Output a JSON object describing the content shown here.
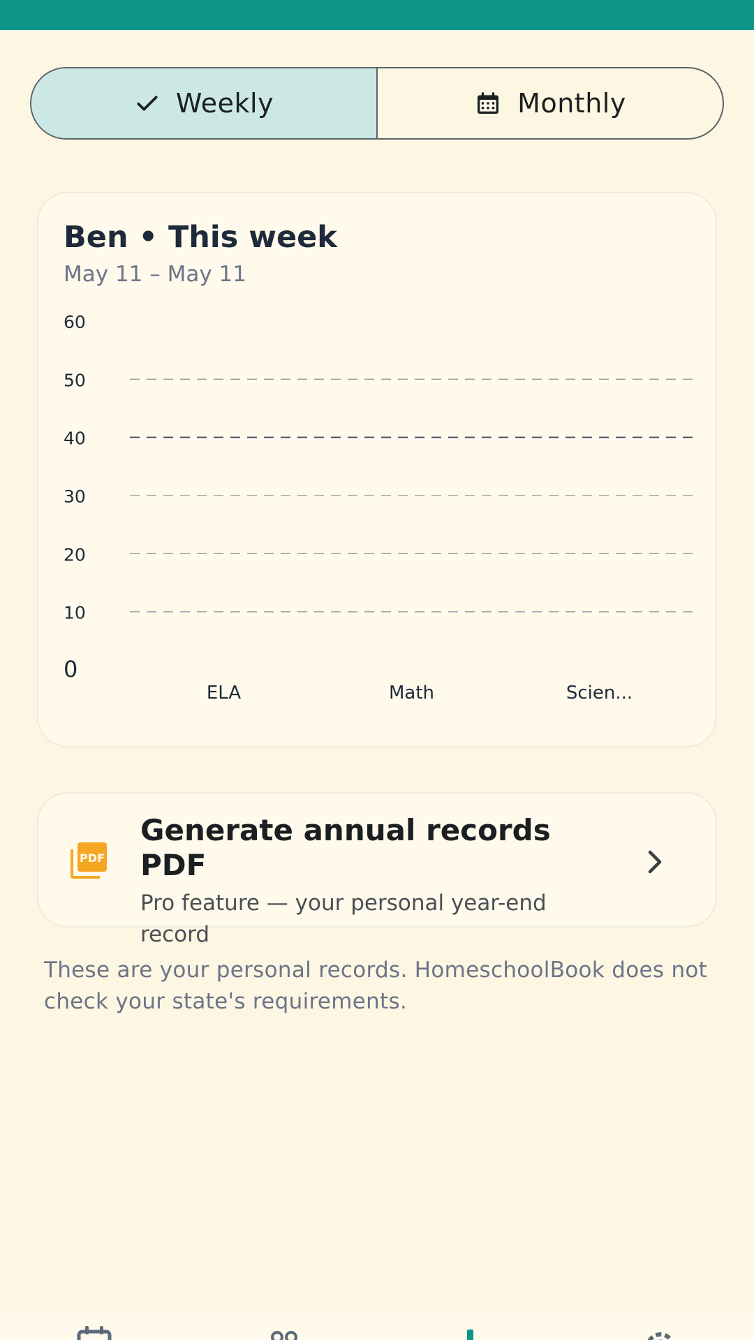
{
  "colors": {
    "accent": "#0E9488",
    "background": "#FDF6E3",
    "card": "#FFFAEB",
    "selected_segment": "#CCE8E4",
    "pdf_icon": "#F5A623"
  },
  "toggle": {
    "weekly_label": "Weekly",
    "weekly_icon": "check-icon",
    "monthly_label": "Monthly",
    "monthly_icon": "calendar-icon",
    "selected": "Weekly"
  },
  "chart_card": {
    "title": "Ben • This week",
    "subtitle": "May 11 – May 11"
  },
  "chart_data": {
    "type": "bar",
    "categories": [
      "ELA",
      "Math",
      "Scien..."
    ],
    "values": [
      0,
      0,
      0
    ],
    "y_ticks": [
      "60",
      "50",
      "40",
      "30",
      "20",
      "10",
      "0"
    ],
    "ylim": [
      0,
      60
    ],
    "highlight_line": 40,
    "grid": true
  },
  "pdf_card": {
    "title": "Generate annual records PDF",
    "subtitle": "Pro feature — your personal year-end record",
    "icon": "pdf-icon"
  },
  "disclaimer": "These are your personal records. HomeschoolBook does not check your state's requirements.",
  "bottom_nav": {
    "items": [
      {
        "icon": "calendar-icon"
      },
      {
        "icon": "people-icon"
      },
      {
        "icon": "bar-chart-icon",
        "active": true
      },
      {
        "icon": "gear-icon"
      }
    ]
  }
}
